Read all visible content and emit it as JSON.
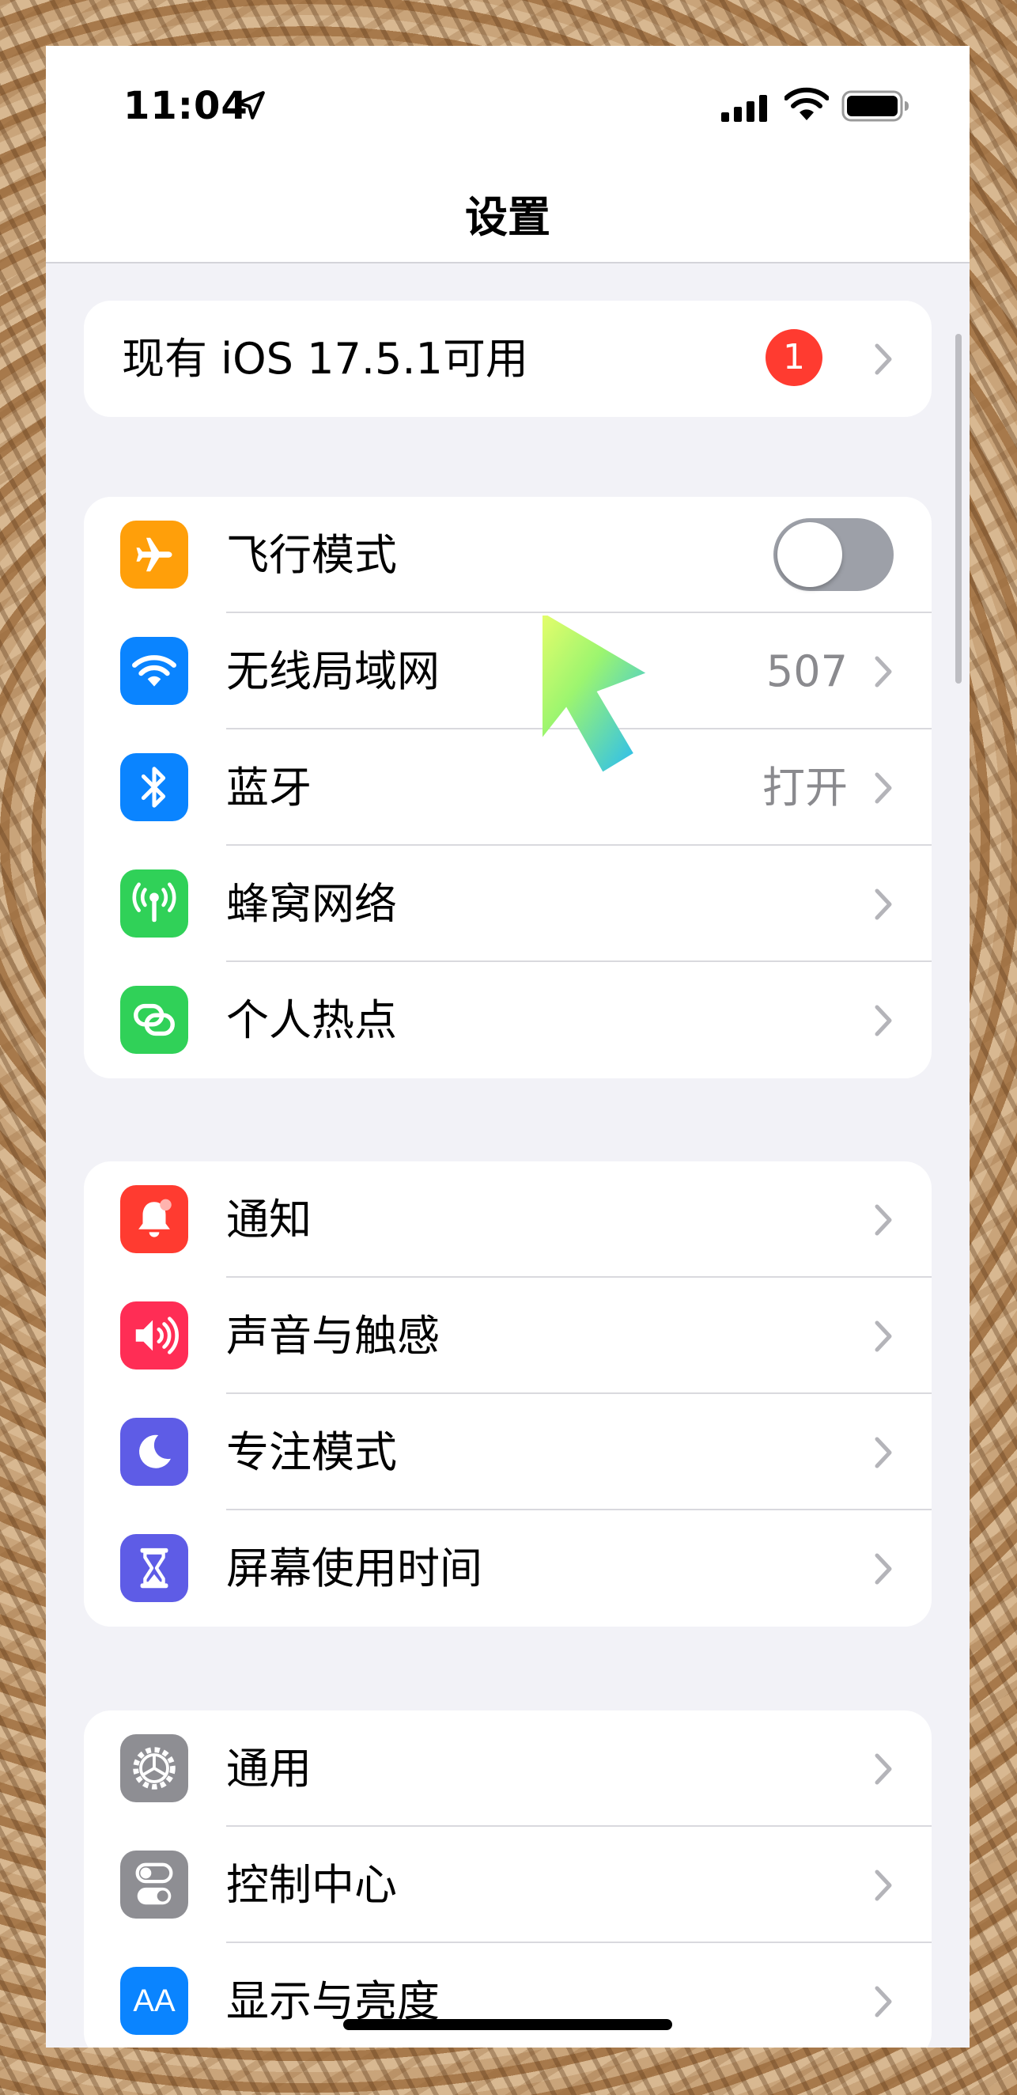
{
  "status_bar": {
    "time": "11:04",
    "icons": [
      "location-arrow-icon",
      "cellular-signal-icon",
      "wifi-icon",
      "battery-icon"
    ]
  },
  "header": {
    "title": "设置"
  },
  "update_banner": {
    "label": "现有 iOS 17.5.1可用",
    "badge": "1"
  },
  "connectivity": {
    "airplane": {
      "label": "飞行模式",
      "icon": "airplane-icon",
      "color": "#ff9f0a",
      "toggle_on": false
    },
    "wifi": {
      "label": "无线局域网",
      "value": "507",
      "icon": "wifi-icon",
      "color": "#0a84ff"
    },
    "bluetooth": {
      "label": "蓝牙",
      "value": "打开",
      "icon": "bluetooth-icon",
      "color": "#0a84ff"
    },
    "cellular": {
      "label": "蜂窝网络",
      "icon": "cellular-antenna-icon",
      "color": "#30d158"
    },
    "hotspot": {
      "label": "个人热点",
      "icon": "hotspot-chain-icon",
      "color": "#30d158"
    }
  },
  "attention": {
    "notifications": {
      "label": "通知",
      "icon": "bell-icon",
      "color": "#ff3b30"
    },
    "sounds": {
      "label": "声音与触感",
      "icon": "speaker-icon",
      "color": "#ff2d55"
    },
    "focus": {
      "label": "专注模式",
      "icon": "moon-icon",
      "color": "#5e5ce6"
    },
    "screen_time": {
      "label": "屏幕使用时间",
      "icon": "hourglass-icon",
      "color": "#5e5ce6"
    }
  },
  "system": {
    "general": {
      "label": "通用",
      "icon": "gear-icon",
      "color": "#8e8e93"
    },
    "control_center": {
      "label": "控制中心",
      "icon": "switches-icon",
      "color": "#8e8e93"
    },
    "display": {
      "label": "显示与亮度",
      "icon": "text-size-icon",
      "icon_text": "AA",
      "color": "#0a84ff"
    }
  }
}
